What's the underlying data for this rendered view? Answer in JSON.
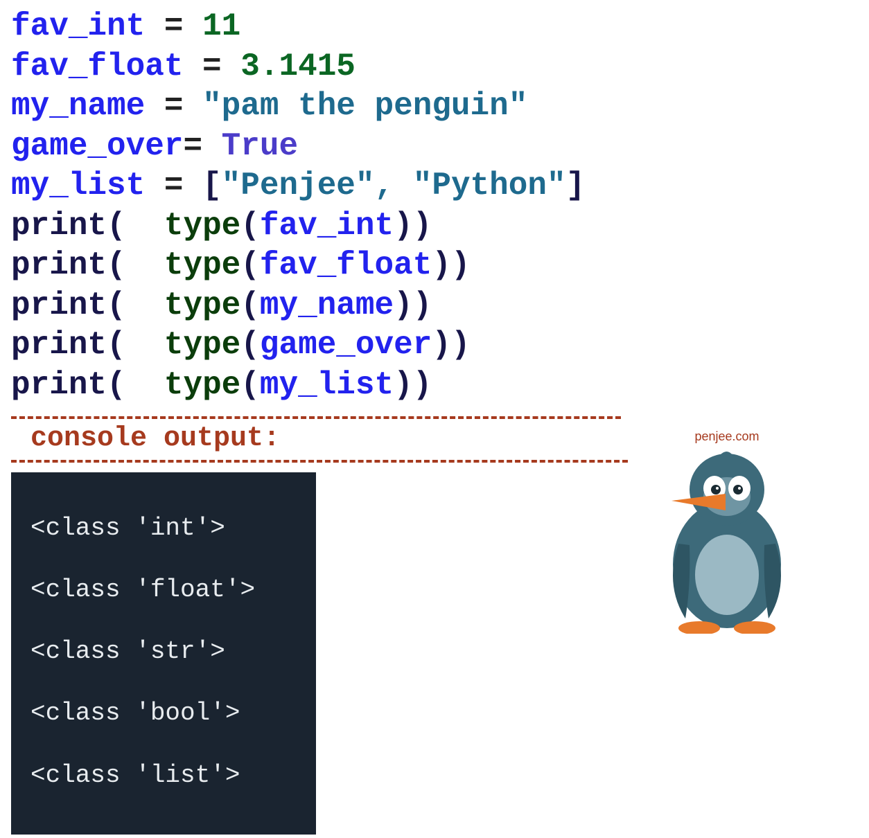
{
  "code": {
    "l1_var": "fav_int",
    "l1_eq": " = ",
    "l1_val": "11",
    "l2_var": "fav_float",
    "l2_eq": " = ",
    "l2_val": "3.1415",
    "l3_var": "my_name",
    "l3_eq": " = ",
    "l3_val": "\"pam the penguin\"",
    "l4_var": "game_over",
    "l4_eq": "= ",
    "l4_val": "True",
    "l5_var": "my_list",
    "l5_eq": " = ",
    "l5_br1": "[",
    "l5_s1": "\"Penjee\"",
    "l5_comma": ", ",
    "l5_s2": "\"Python\"",
    "l5_br2": "]",
    "p_print": "print",
    "p_open": "(  ",
    "p_type": "type",
    "p_open2": "(",
    "p_close2": ")",
    "p_close": ")",
    "a1": "fav_int",
    "a2": "fav_float",
    "a3": "my_name",
    "a4": "game_over",
    "a5": "my_list"
  },
  "console_label": "console output:",
  "output": [
    "<class 'int'>",
    "<class 'float'>",
    "<class 'str'>",
    "<class 'bool'>",
    "<class 'list'>"
  ],
  "penguin_caption": "penjee.com"
}
